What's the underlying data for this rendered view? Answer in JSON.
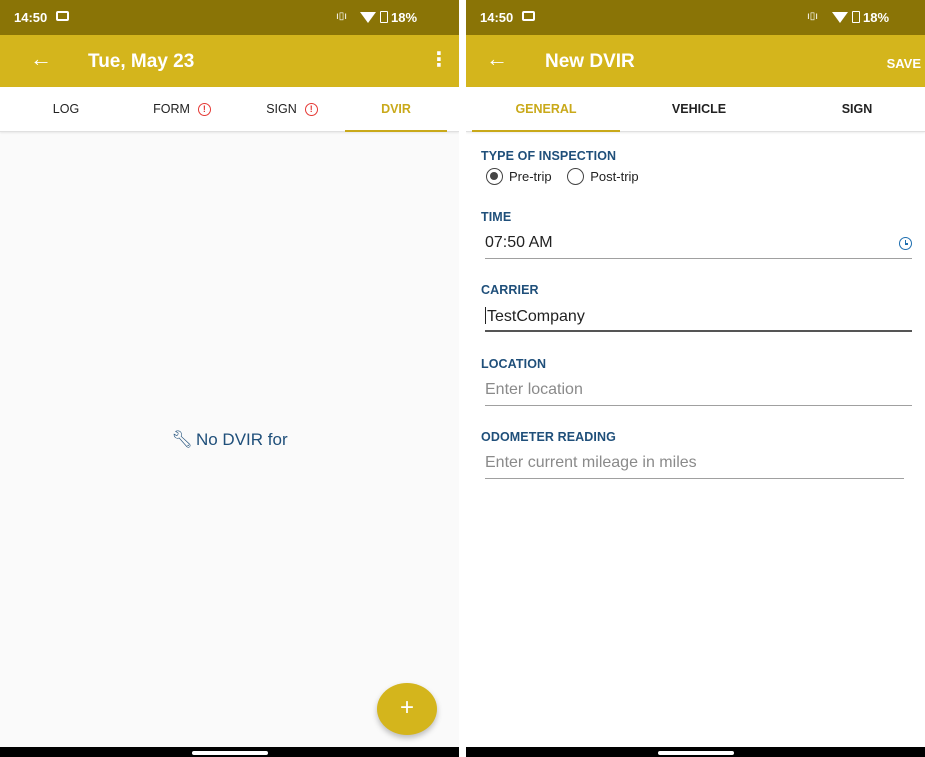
{
  "status": {
    "time": "14:50",
    "battery": "18%"
  },
  "left": {
    "appbar": {
      "title": "Tue, May 23"
    },
    "tabs": [
      {
        "label": "LOG",
        "alert": false
      },
      {
        "label": "FORM",
        "alert": true
      },
      {
        "label": "SIGN",
        "alert": true
      },
      {
        "label": "DVIR",
        "alert": false,
        "active": true
      }
    ],
    "empty_message": "No DVIR for",
    "fab_label": "+"
  },
  "right": {
    "appbar": {
      "title": "New DVIR",
      "save_label": "SAVE"
    },
    "tabs": [
      {
        "label": "GENERAL",
        "active": true
      },
      {
        "label": "VEHICLE"
      },
      {
        "label": "SIGN"
      }
    ],
    "form": {
      "inspection_type": {
        "label": "TYPE OF INSPECTION",
        "options": [
          "Pre-trip",
          "Post-trip"
        ],
        "selected": "Pre-trip"
      },
      "time": {
        "label": "TIME",
        "value": "07:50 AM"
      },
      "carrier": {
        "label": "CARRIER",
        "value": "TestCompany"
      },
      "location": {
        "label": "LOCATION",
        "placeholder": "Enter location"
      },
      "odometer": {
        "label": "ODOMETER READING",
        "placeholder": "Enter current mileage in miles"
      }
    }
  },
  "colors": {
    "status_bar": "#8a7406",
    "app_bar": "#d4b51c",
    "accent": "#c9a91a",
    "label_blue": "#1f4f7a",
    "alert_red": "#e53935"
  },
  "icons": {
    "back": "arrow-left-icon",
    "menu": "more-vert-icon",
    "alert": "alert-circle-icon",
    "wrench": "wrench-icon",
    "clock": "clock-icon",
    "add": "plus-icon"
  }
}
